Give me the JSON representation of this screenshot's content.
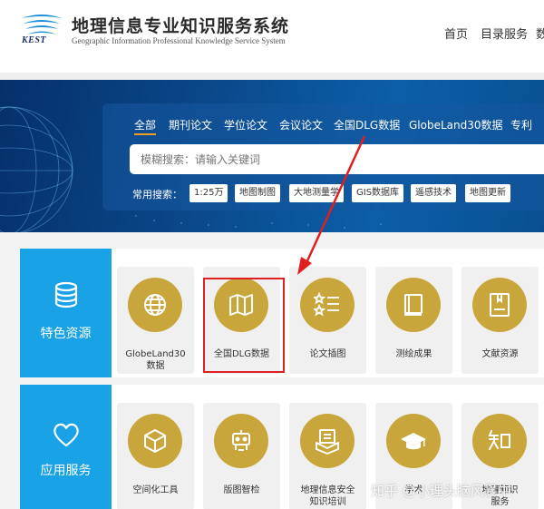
{
  "header": {
    "logo_text": "KEST",
    "title": "地理信息专业知识服务系统",
    "subtitle": "Geographic Information Professional Knowledge Service System",
    "nav": [
      "首页",
      "目录服务",
      "数"
    ]
  },
  "search": {
    "tabs": [
      "全部",
      "期刊论文",
      "学位论文",
      "会议论文",
      "全国DLG数据",
      "GlobeLand30数据",
      "专利"
    ],
    "placeholder": "模糊搜索：请输入关键词",
    "common_label": "常用搜索：",
    "chips": [
      "1:25万",
      "地图制图",
      "大地测量学",
      "GIS数据库",
      "遥感技术",
      "地图更新"
    ]
  },
  "sections": [
    {
      "label": "特色资源",
      "icon": "database-icon",
      "cards": [
        {
          "label_lines": [
            "GlobeLand30",
            "数据"
          ],
          "icon": "globe-icon"
        },
        {
          "label_lines": [
            "全国DLG数据"
          ],
          "icon": "map-icon"
        },
        {
          "label_lines": [
            "论文插图"
          ],
          "icon": "star-list-icon"
        },
        {
          "label_lines": [
            "测绘成果"
          ],
          "icon": "book-icon"
        },
        {
          "label_lines": [
            "文献资源"
          ],
          "icon": "document-icon"
        }
      ]
    },
    {
      "label": "应用服务",
      "icon": "heart-icon",
      "cards": [
        {
          "label_lines": [
            "空间化工具"
          ],
          "icon": "cube-icon"
        },
        {
          "label_lines": [
            "版图智检"
          ],
          "icon": "robot-icon"
        },
        {
          "label_lines": [
            "地理信息安全",
            "知识培训"
          ],
          "icon": "reader-icon"
        },
        {
          "label_lines": [
            "学术"
          ],
          "icon": "graduation-cap-icon"
        },
        {
          "label_lines": [
            "地理知识",
            "服务"
          ],
          "icon": "zhi-icon"
        }
      ]
    }
  ],
  "watermark": "知乎 @小理头脑风暴中",
  "colors": {
    "accent_blue": "#1aa2e6",
    "gold": "#c9a63b",
    "highlight_red": "#e02020",
    "tab_underline": "#f0a020"
  }
}
